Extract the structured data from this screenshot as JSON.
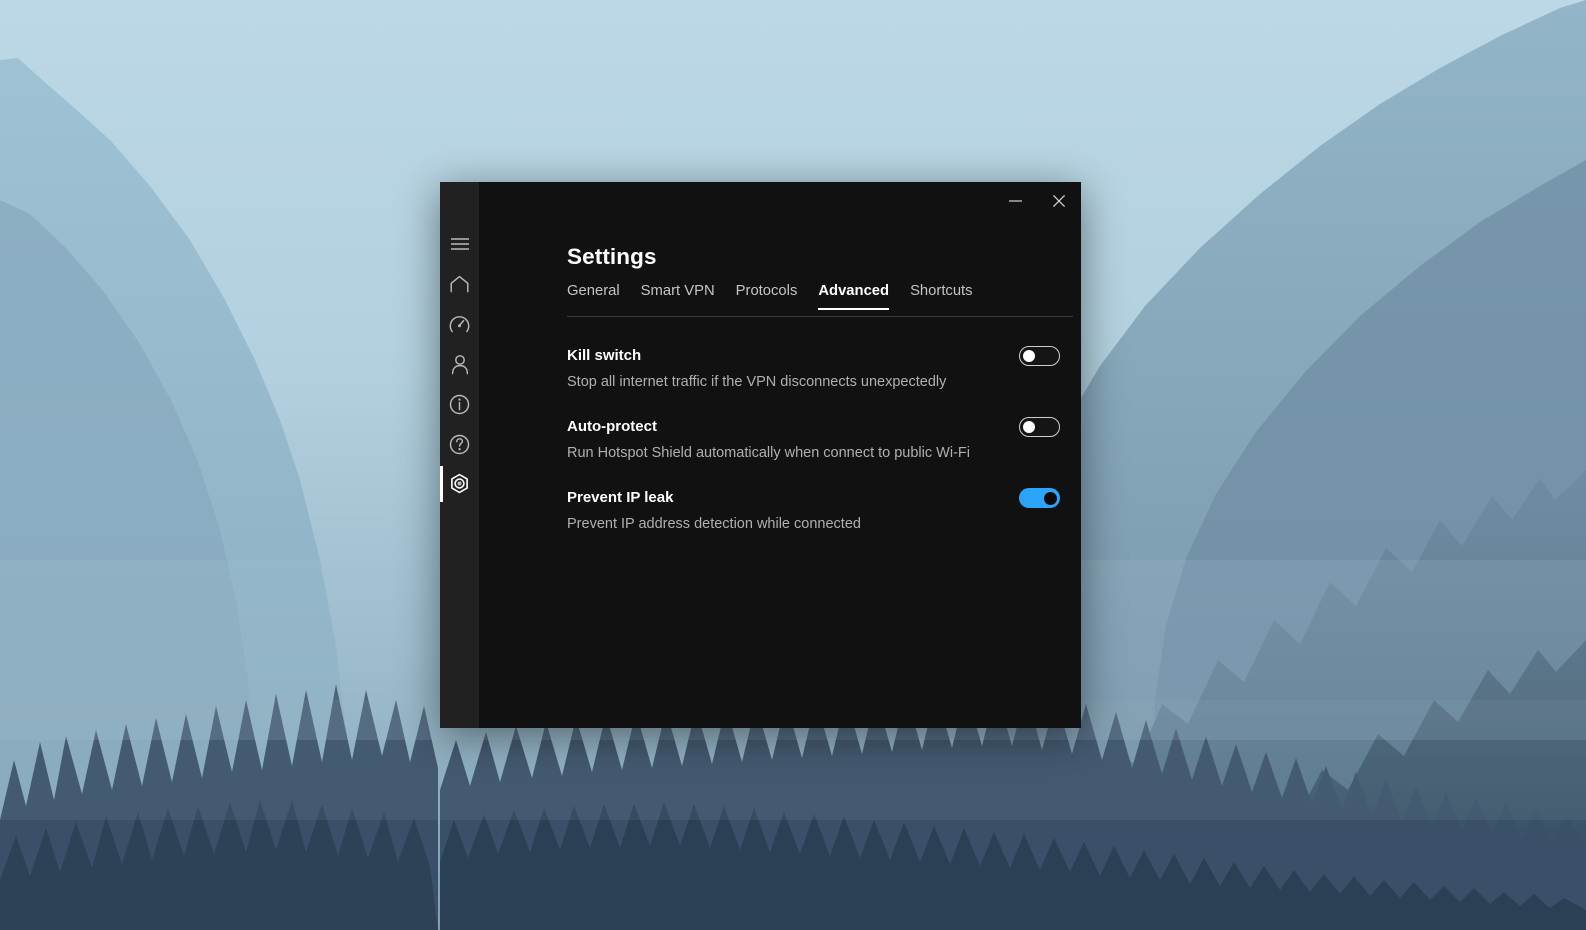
{
  "desktop": {
    "wallpaper_name": "mountain-forest-wallpaper",
    "colors": {
      "sky_top": "#b9d6e4",
      "sky_bottom": "#8fb0c2",
      "mountain_far": "#9dc0d2",
      "mountain_mid": "#86a8bc",
      "forest_dark": "#3e556b",
      "forest_darker": "#2f4358"
    }
  },
  "window": {
    "accent_color": "#2da4f7",
    "background": "#111111",
    "sidebar_background": "#212121",
    "titlebar": {
      "minimize_label": "Minimize",
      "minimize_icon": "minimize-icon",
      "close_label": "Close",
      "close_icon": "close-icon"
    },
    "title": "Settings"
  },
  "sidebar": {
    "items": [
      {
        "name": "menu",
        "icon": "hamburger-menu-icon",
        "label": "Menu",
        "active": false
      },
      {
        "name": "home",
        "icon": "home-icon",
        "label": "Home",
        "active": false
      },
      {
        "name": "speed",
        "icon": "speedometer-icon",
        "label": "Speed test",
        "active": false
      },
      {
        "name": "account",
        "icon": "person-icon",
        "label": "Account",
        "active": false
      },
      {
        "name": "info",
        "icon": "info-circle-icon",
        "label": "Info",
        "active": false
      },
      {
        "name": "help",
        "icon": "help-circle-icon",
        "label": "Help",
        "active": false
      },
      {
        "name": "settings",
        "icon": "gear-nut-icon",
        "label": "Settings",
        "active": true
      }
    ]
  },
  "tabs": [
    {
      "label": "General",
      "active": false
    },
    {
      "label": "Smart VPN",
      "active": false
    },
    {
      "label": "Protocols",
      "active": false
    },
    {
      "label": "Advanced",
      "active": true
    },
    {
      "label": "Shortcuts",
      "active": false
    }
  ],
  "settings": [
    {
      "title": "Kill switch",
      "description": "Stop all internet traffic if the VPN disconnects unexpectedly",
      "toggle_state": "off"
    },
    {
      "title": "Auto-protect",
      "description": "Run Hotspot Shield automatically when connect to public Wi-Fi",
      "toggle_state": "off"
    },
    {
      "title": "Prevent IP leak",
      "description": "Prevent IP address detection while connected",
      "toggle_state": "on"
    }
  ]
}
